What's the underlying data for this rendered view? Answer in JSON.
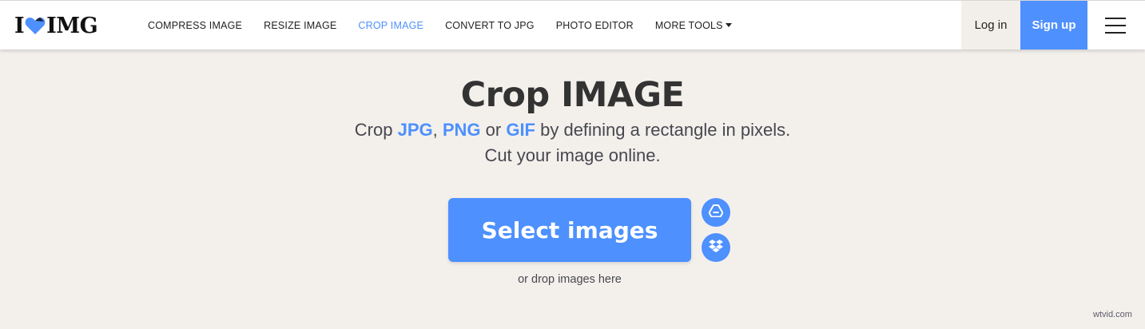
{
  "brand": {
    "logo_left": "I",
    "logo_right": "IMG",
    "accent": "#4d90fe"
  },
  "nav": {
    "items": [
      {
        "label": "COMPRESS IMAGE"
      },
      {
        "label": "RESIZE IMAGE"
      },
      {
        "label": "CROP IMAGE",
        "active": true
      },
      {
        "label": "CONVERT TO JPG"
      },
      {
        "label": "PHOTO EDITOR"
      },
      {
        "label": "MORE TOOLS"
      }
    ]
  },
  "auth": {
    "login_label": "Log in",
    "signup_label": "Sign up"
  },
  "hero": {
    "title": "Crop IMAGE",
    "sub1_pre": "Crop ",
    "fmt_jpg": "JPG",
    "sep1": ", ",
    "fmt_png": "PNG",
    "sep2": " or ",
    "fmt_gif": "GIF",
    "sub1_post": " by defining a rectangle in pixels.",
    "sub2": "Cut your image online."
  },
  "upload": {
    "select_label": "Select images",
    "drop_hint": "or drop images here",
    "icons": [
      "google-drive-icon",
      "dropbox-icon"
    ]
  },
  "watermark": "wtvid.com"
}
